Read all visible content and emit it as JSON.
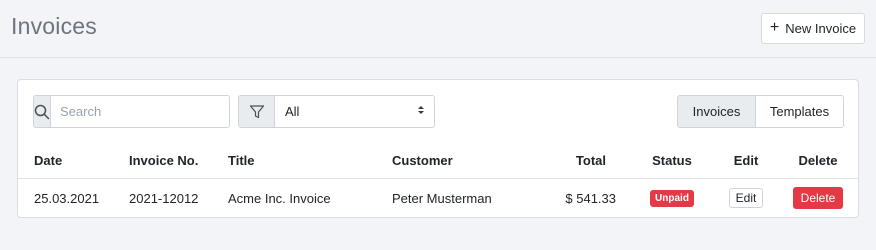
{
  "page": {
    "title": "Invoices"
  },
  "actions": {
    "new_invoice_label": "New Invoice",
    "new_invoice_icon": "plus-icon"
  },
  "toolbar": {
    "search": {
      "placeholder": "Search",
      "value": "",
      "icon": "search-icon"
    },
    "filter": {
      "selected": "All",
      "icon": "filter-icon"
    },
    "view_toggle": [
      {
        "label": "Invoices",
        "active": true
      },
      {
        "label": "Templates",
        "active": false
      }
    ]
  },
  "table": {
    "columns": [
      "Date",
      "Invoice No.",
      "Title",
      "Customer",
      "Total",
      "Status",
      "Edit",
      "Delete"
    ],
    "rows": [
      {
        "date": "25.03.2021",
        "invoice_no": "2021-12012",
        "title": "Acme Inc. Invoice",
        "customer": "Peter Musterman",
        "total": "$ 541.33",
        "status": "Unpaid",
        "edit_label": "Edit",
        "delete_label": "Delete"
      }
    ]
  },
  "colors": {
    "danger": "#e53945",
    "muted_title": "#6c757d",
    "background": "#f2f4f7"
  }
}
